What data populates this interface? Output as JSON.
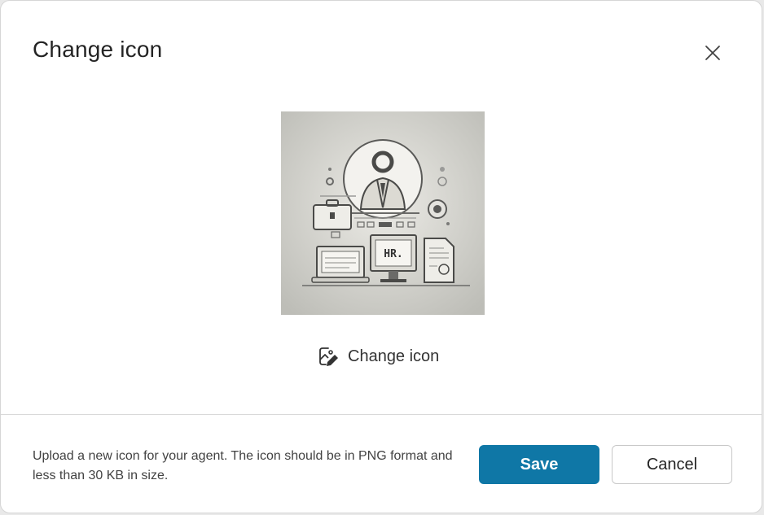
{
  "dialog": {
    "title": "Change icon",
    "close_icon": "close-icon",
    "preview": {
      "badge_text": "HR."
    },
    "change_icon_label": "Change icon",
    "change_icon_icon": "image-edit-icon",
    "hint": "Upload a new icon for your agent. The icon should be in PNG format and less than 30 KB in size.",
    "save_label": "Save",
    "cancel_label": "Cancel"
  },
  "colors": {
    "primary": "#0f77a6",
    "text": "#242424",
    "divider": "#d9d9d9"
  }
}
